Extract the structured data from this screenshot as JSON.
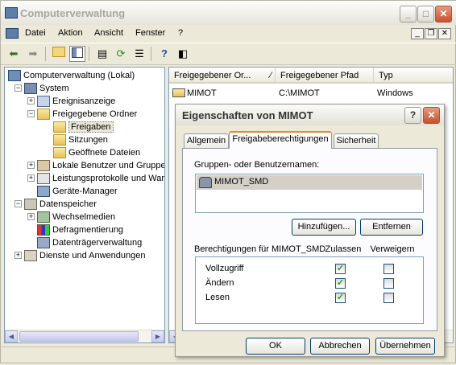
{
  "window": {
    "title": "Computerverwaltung"
  },
  "menu": [
    "Datei",
    "Aktion",
    "Ansicht",
    "Fenster",
    "?"
  ],
  "tree": {
    "root": "Computerverwaltung (Lokal)",
    "items": [
      {
        "label": "System"
      },
      {
        "label": "Ereignisanzeige"
      },
      {
        "label": "Freigegebene Ordner"
      },
      {
        "label": "Freigaben"
      },
      {
        "label": "Sitzungen"
      },
      {
        "label": "Geöffnete Dateien"
      },
      {
        "label": "Lokale Benutzer und Gruppen"
      },
      {
        "label": "Leistungsprotokolle und Warnungen"
      },
      {
        "label": "Geräte-Manager"
      },
      {
        "label": "Datenspeicher"
      },
      {
        "label": "Wechselmedien"
      },
      {
        "label": "Defragmentierung"
      },
      {
        "label": "Datenträgerverwaltung"
      },
      {
        "label": "Dienste und Anwendungen"
      }
    ]
  },
  "list": {
    "columns": [
      "Freigegebener Or...",
      "Freigegebener Pfad",
      "Typ"
    ],
    "rows": [
      {
        "name": "MIMOT",
        "path": "C:\\MIMOT",
        "type": "Windows"
      }
    ]
  },
  "dialog": {
    "title": "Eigenschaften von MIMOT",
    "tabs": [
      "Allgemein",
      "Freigabeberechtigungen",
      "Sicherheit"
    ],
    "groups_label": "Gruppen- oder Benutzernamen:",
    "users": [
      "MIMOT_SMD"
    ],
    "add_button": "Hinzufügen...",
    "remove_button": "Entfernen",
    "perm_label": "Berechtigungen für MIMOT_SMD",
    "allow_header": "Zulassen",
    "deny_header": "Verweigern",
    "permissions": [
      {
        "name": "Vollzugriff",
        "allow": true,
        "deny": false
      },
      {
        "name": "Ändern",
        "allow": true,
        "deny": false
      },
      {
        "name": "Lesen",
        "allow": true,
        "deny": false
      }
    ],
    "ok": "OK",
    "cancel": "Abbrechen",
    "apply": "Übernehmen"
  }
}
